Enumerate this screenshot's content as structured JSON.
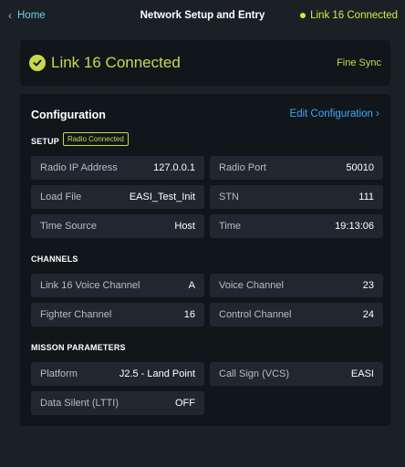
{
  "header": {
    "back_label": "Home",
    "title": "Network Setup and Entry",
    "status": "Link 16 Connected"
  },
  "banner": {
    "text": "Link 16 Connected",
    "sync": "Fine Sync"
  },
  "config": {
    "title": "Configuration",
    "edit_label": "Edit Configuration",
    "setup": {
      "label": "SETUP",
      "badge": "Radio Connected",
      "fields": [
        {
          "label": "Radio IP Address",
          "value": "127.0.0.1"
        },
        {
          "label": "Radio Port",
          "value": "50010"
        },
        {
          "label": "Load File",
          "value": "EASI_Test_Init"
        },
        {
          "label": "STN",
          "value": "111"
        },
        {
          "label": "Time Source",
          "value": "Host"
        },
        {
          "label": "Time",
          "value": "19:13:06"
        }
      ]
    },
    "channels": {
      "label": "CHANNELS",
      "fields": [
        {
          "label": "Link 16 Voice Channel",
          "value": "A"
        },
        {
          "label": "Voice Channel",
          "value": "23"
        },
        {
          "label": "Fighter Channel",
          "value": "16"
        },
        {
          "label": "Control Channel",
          "value": "24"
        }
      ]
    },
    "mission": {
      "label": "MISSON PARAMETERS",
      "fields": [
        {
          "label": "Platform",
          "value": "J2.5 - Land Point"
        },
        {
          "label": "Call Sign (VCS)",
          "value": "EASI"
        },
        {
          "label": "Data Silent (LTTI)",
          "value": "OFF"
        }
      ]
    }
  }
}
